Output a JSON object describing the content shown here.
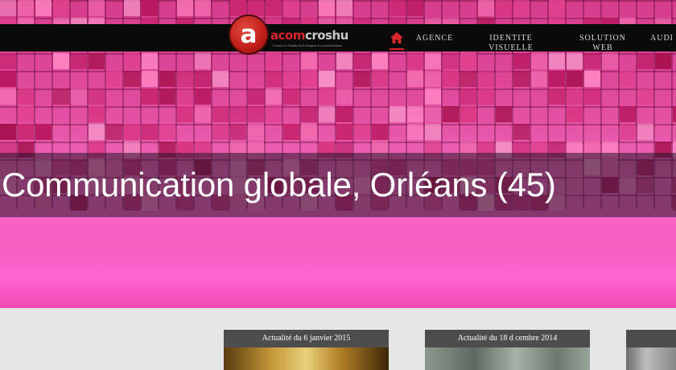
{
  "brand": {
    "logo_letter": "a",
    "logo_part1": "acom",
    "logo_part2": "croshu",
    "tagline": "Conseil en Relations Publiques & communication"
  },
  "nav": {
    "items": [
      {
        "label": "AGENCE"
      },
      {
        "label": "IDENTITE VISUELLE"
      },
      {
        "label": "SOLUTION WEB"
      },
      {
        "label": "AUDI"
      }
    ]
  },
  "hero": {
    "title": "Communication globale, Orléans (45)"
  },
  "news": [
    {
      "date_label": "Actualité du 6 janvier 2015"
    },
    {
      "date_label": "Actualité du 18 d cembre 2014"
    },
    {
      "date_label": ""
    }
  ],
  "colors": {
    "accent": "#d6262b",
    "hero_pink": "#f45fc0",
    "bar": "#0a0a0a"
  }
}
